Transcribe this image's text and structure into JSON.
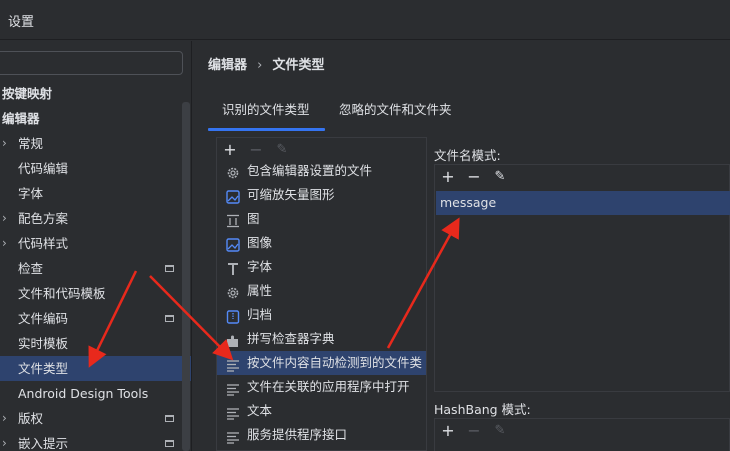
{
  "window": {
    "title": "设置"
  },
  "sidebar": {
    "items": [
      {
        "label": "按键映射",
        "bold": true,
        "arrow": false,
        "indent": 2
      },
      {
        "label": "编辑器",
        "bold": true,
        "arrow": false,
        "indent": 2
      },
      {
        "label": "常规",
        "arrow": true,
        "indent": 18
      },
      {
        "label": "代码编辑",
        "arrow": false,
        "indent": 18
      },
      {
        "label": "字体",
        "arrow": false,
        "indent": 18
      },
      {
        "label": "配色方案",
        "arrow": true,
        "indent": 18
      },
      {
        "label": "代码样式",
        "arrow": true,
        "indent": 18
      },
      {
        "label": "检查",
        "arrow": false,
        "indent": 18,
        "mini": true
      },
      {
        "label": "文件和代码模板",
        "arrow": false,
        "indent": 18
      },
      {
        "label": "文件编码",
        "arrow": false,
        "indent": 18,
        "mini": true
      },
      {
        "label": "实时模板",
        "arrow": false,
        "indent": 18
      },
      {
        "label": "文件类型",
        "arrow": false,
        "indent": 18,
        "selected": true
      },
      {
        "label": "Android Design Tools",
        "arrow": false,
        "indent": 18
      },
      {
        "label": "版权",
        "arrow": true,
        "indent": 18,
        "mini": true
      },
      {
        "label": "嵌入提示",
        "arrow": true,
        "indent": 18,
        "mini": true
      }
    ]
  },
  "breadcrumb": {
    "parent": "编辑器",
    "separator": "›",
    "current": "文件类型"
  },
  "tabs": [
    {
      "label": "识别的文件类型",
      "active": true
    },
    {
      "label": "忽略的文件和文件夹",
      "active": false
    }
  ],
  "toolbar_icons": {
    "add": "+",
    "remove": "−",
    "edit": "✎"
  },
  "file_types": [
    {
      "label": "包含编辑器设置的文件",
      "icon": "gear-icon"
    },
    {
      "label": "可缩放矢量图形",
      "icon": "image-icon"
    },
    {
      "label": "图",
      "icon": "diagram-icon"
    },
    {
      "label": "图像",
      "icon": "image-icon"
    },
    {
      "label": "字体",
      "icon": "font-icon"
    },
    {
      "label": "属性",
      "icon": "gear-icon"
    },
    {
      "label": "归档",
      "icon": "archive-icon"
    },
    {
      "label": "拼写检查器字典",
      "icon": "puzzle-icon"
    },
    {
      "label": "按文件内容自动检测到的文件类",
      "icon": "text-icon",
      "selected": true
    },
    {
      "label": "文件在关联的应用程序中打开",
      "icon": "text-icon"
    },
    {
      "label": "文本",
      "icon": "text-icon"
    },
    {
      "label": "服务提供程序接口",
      "icon": "text-icon"
    }
  ],
  "filename_patterns": {
    "label": "文件名模式:",
    "items": [
      "message"
    ]
  },
  "hashbang": {
    "label": "HashBang 模式:"
  },
  "colors": {
    "selection": "#2e436e",
    "accent": "#3574f0",
    "annotation_arrow": "#e8291c"
  }
}
